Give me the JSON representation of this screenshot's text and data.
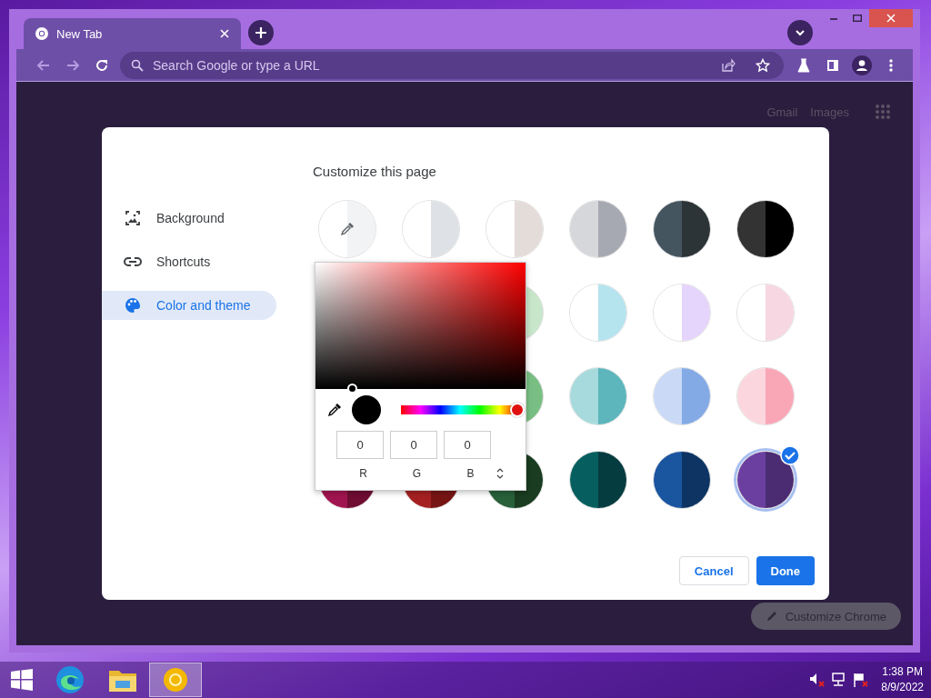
{
  "tabs": [
    {
      "label": "New Tab",
      "selected": true
    }
  ],
  "omnibox": {
    "placeholder": "Search Google or type a URL"
  },
  "page_links": [
    "Gmail",
    "Images"
  ],
  "dialog": {
    "title": "Customize this page",
    "sidebar": [
      {
        "label": "Background",
        "selected": false
      },
      {
        "label": "Shortcuts",
        "selected": false
      },
      {
        "label": "Color and theme",
        "selected": true
      }
    ],
    "swatches": [
      [
        {
          "kind": "custom",
          "halves": [
            {
              "color": "#ffffff"
            },
            {
              "color": "#f1f3f4"
            }
          ],
          "selected": false
        },
        {
          "kind": "swatch",
          "halves": [
            {
              "color": "#ffffff"
            },
            {
              "color": "#dee1e6"
            }
          ],
          "selected": false
        },
        {
          "kind": "swatch",
          "halves": [
            {
              "color": "#ffffff"
            },
            {
              "color": "#e3dcd9"
            }
          ],
          "selected": false
        },
        {
          "kind": "swatch",
          "halves": [
            {
              "color": "#d5d7db"
            },
            {
              "color": "#a7a9b2"
            }
          ],
          "selected": false
        },
        {
          "kind": "swatch",
          "halves": [
            {
              "color": "#455560"
            },
            {
              "color": "#2c3437"
            }
          ],
          "selected": false
        },
        {
          "kind": "swatch",
          "halves": [
            {
              "color": "#333333"
            },
            {
              "color": "#000000"
            }
          ],
          "selected": false
        }
      ],
      [
        {
          "kind": "covered"
        },
        {
          "kind": "covered"
        },
        {
          "kind": "swatch",
          "halves": [
            {
              "color": "#c8e6c9"
            }
          ],
          "selected": false
        },
        {
          "kind": "swatch",
          "halves": [
            {
              "color": "#ffffff"
            },
            {
              "color": "#b5e4ee"
            }
          ],
          "selected": false
        },
        {
          "kind": "swatch",
          "halves": [
            {
              "color": "#ffffff"
            },
            {
              "color": "#e5d4fb"
            }
          ],
          "selected": false
        },
        {
          "kind": "swatch",
          "halves": [
            {
              "color": "#ffffff"
            },
            {
              "color": "#f7d7e2"
            }
          ],
          "selected": false
        }
      ],
      [
        {
          "kind": "covered"
        },
        {
          "kind": "covered"
        },
        {
          "kind": "swatch",
          "halves": [
            {
              "color": "#79bf83"
            }
          ],
          "selected": false
        },
        {
          "kind": "swatch",
          "halves": [
            {
              "color": "#a7dadc"
            },
            {
              "color": "#5cb6bc"
            }
          ],
          "selected": false
        },
        {
          "kind": "swatch",
          "halves": [
            {
              "color": "#c9d9f6"
            },
            {
              "color": "#84aae6"
            }
          ],
          "selected": false
        },
        {
          "kind": "swatch",
          "halves": [
            {
              "color": "#fcd6de"
            },
            {
              "color": "#f9a7b7"
            }
          ],
          "selected": false
        }
      ],
      [
        {
          "kind": "swatch",
          "halves": [
            {
              "color": "#a0154f"
            },
            {
              "color": "#6f0d33"
            }
          ],
          "selected": false
        },
        {
          "kind": "swatch",
          "halves": [
            {
              "color": "#a52121"
            },
            {
              "color": "#771515"
            }
          ],
          "selected": false
        },
        {
          "kind": "swatch",
          "halves": [
            {
              "color": "#28603a"
            },
            {
              "color": "#1a3c20"
            }
          ],
          "selected": false
        },
        {
          "kind": "swatch",
          "halves": [
            {
              "color": "#075e5f"
            },
            {
              "color": "#053c40"
            }
          ],
          "selected": false
        },
        {
          "kind": "swatch",
          "halves": [
            {
              "color": "#1a55a0"
            },
            {
              "color": "#0d3463"
            }
          ],
          "selected": false
        },
        {
          "kind": "swatch",
          "halves": [
            {
              "color": "#6b3fa0"
            },
            {
              "color": "#4b2c73"
            }
          ],
          "selected": true
        }
      ]
    ],
    "color_picker": {
      "hue": {
        "level": 1
      },
      "fields": [
        {
          "label": "R",
          "value": "0"
        },
        {
          "label": "G",
          "value": "0"
        },
        {
          "label": "B",
          "value": "0"
        }
      ]
    },
    "buttons": [
      {
        "label": "Cancel",
        "kind": "secondary"
      },
      {
        "label": "Done",
        "kind": "primary"
      }
    ]
  },
  "customize_button": {
    "label": "Customize Chrome"
  },
  "taskbar": {
    "apps": [
      {
        "selected": false
      },
      {
        "selected": false
      },
      {
        "selected": true
      }
    ],
    "time": "1:38 PM",
    "date": "8/9/2022"
  }
}
